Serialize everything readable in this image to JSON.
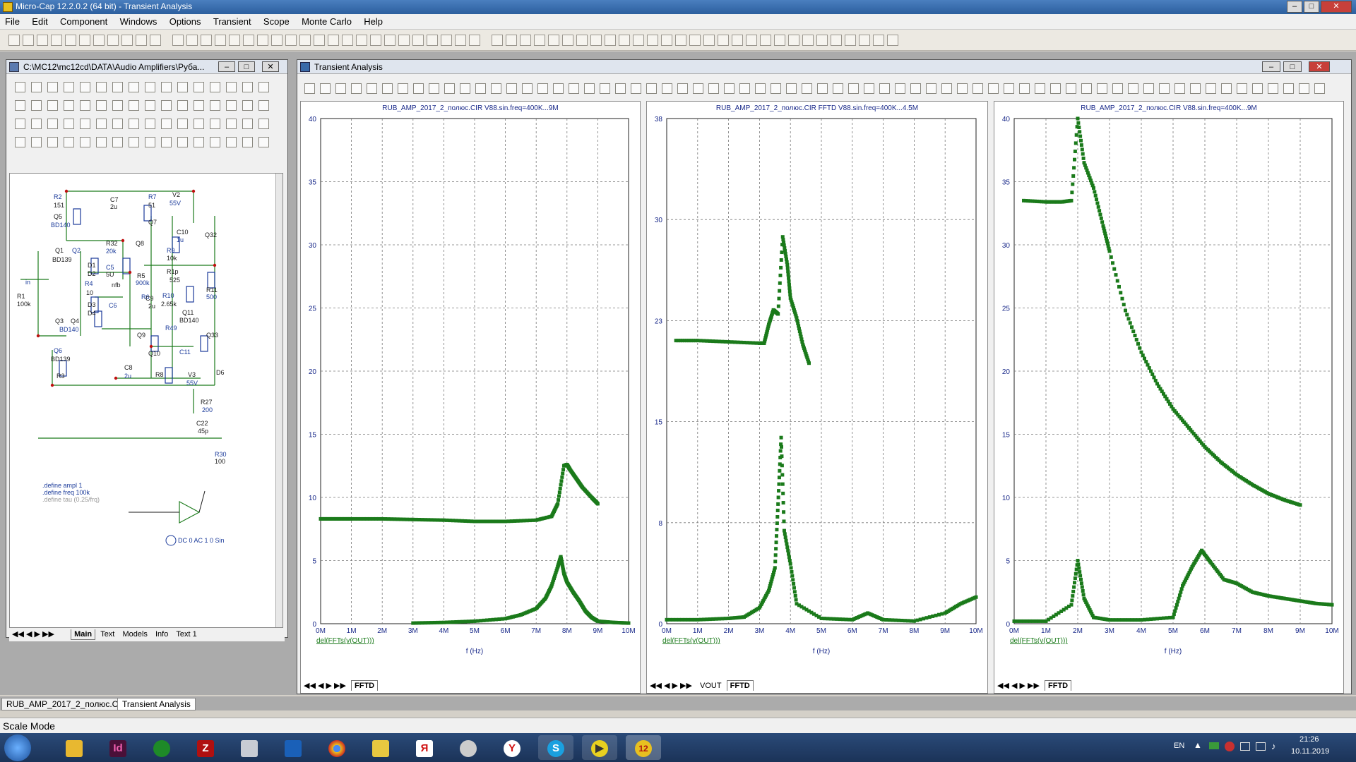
{
  "app": {
    "title": "Micro-Cap 12.2.0.2 (64 bit) - Transient Analysis"
  },
  "menu": [
    "File",
    "Edit",
    "Component",
    "Windows",
    "Options",
    "Transient",
    "Scope",
    "Monte Carlo",
    "Help"
  ],
  "schematic_window": {
    "title": "C:\\MC12\\mc12cd\\DATA\\Audio Amplifiers\\Руба...",
    "labels": [
      "R2",
      "151",
      "Q5",
      "BD140",
      "C7",
      "2u",
      "R7",
      "51",
      "V2",
      "55V",
      "Q7",
      "C10",
      "1u",
      "Q32",
      "Q8",
      "R9",
      "10k",
      "Q1",
      "Q2",
      "BD139",
      "R32",
      "20k",
      "D1",
      "D2",
      "C5",
      "5U",
      "R5",
      "900k",
      "R1p",
      "525",
      "R4",
      "10",
      "nfb",
      "R6",
      "C9",
      "2u",
      "R10",
      "2.65k",
      "R11",
      "500",
      "R1",
      "100k",
      "in",
      "D3",
      "D4",
      "C6",
      "Q11",
      "BD140",
      "R49",
      "Q3",
      "Q4",
      "BD140",
      "Q9",
      "Q33",
      "Q6",
      "BD139",
      "Q10",
      "C11",
      "D6",
      "C8",
      "2u",
      "R8",
      "V3",
      "55V",
      "R3",
      "R27",
      "200",
      "C22",
      "45p",
      "R30",
      "100"
    ],
    "defines": [
      ".define ampl 1",
      ".define freq 100k",
      ".define tau (0.25/frq)"
    ],
    "source_label": "DC 0 AC 1 0 Sin",
    "tabs": [
      "Main",
      "Text",
      "Models",
      "Info",
      "Text 1"
    ],
    "active_tab": "Main"
  },
  "transient_window": {
    "title": "Transient Analysis"
  },
  "plots": [
    {
      "title": "RUB_AMP_2017_2_полюс.CIR V88.sin.freq=400K...9M",
      "y_ticks": [
        "40",
        "35",
        "30",
        "25",
        "20",
        "15",
        "10",
        "5",
        "0"
      ],
      "x_ticks": [
        "0M",
        "1M",
        "2M",
        "3M",
        "4M",
        "5M",
        "6M",
        "7M",
        "8M",
        "9M",
        "10M"
      ],
      "curve_label": "del(FFTs(v(OUT)))",
      "xlabel": "f (Hz)",
      "tabs": [
        "FFTD"
      ],
      "active_tab": "FFTD"
    },
    {
      "title": "RUB_AMP_2017_2_полюс.CIR FFTD V88.sin.freq=400K...4.5M",
      "y_ticks": [
        "38",
        "30",
        "23",
        "15",
        "8",
        "0"
      ],
      "x_ticks": [
        "0M",
        "1M",
        "2M",
        "3M",
        "4M",
        "5M",
        "6M",
        "7M",
        "8M",
        "9M",
        "10M"
      ],
      "curve_label": "del(FFTs(v(OUT)))",
      "xlabel": "f (Hz)",
      "tabs": [
        "VOUT",
        "FFTD"
      ],
      "active_tab": "FFTD"
    },
    {
      "title": "RUB_AMP_2017_2_полюс.CIR V88.sin.freq=400K...9M",
      "y_ticks": [
        "40",
        "35",
        "30",
        "25",
        "20",
        "15",
        "10",
        "5",
        "0"
      ],
      "x_ticks": [
        "0M",
        "1M",
        "2M",
        "3M",
        "4M",
        "5M",
        "6M",
        "7M",
        "8M",
        "9M",
        "10M"
      ],
      "curve_label": "del(FFTs(v(OUT)))",
      "xlabel": "f (Hz)",
      "tabs": [
        "FFTD"
      ],
      "active_tab": "FFTD"
    }
  ],
  "chart_data": [
    {
      "type": "scatter",
      "title": "RUB_AMP_2017_2_полюс.CIR V88.sin.freq=400K...9M",
      "xlabel": "f (Hz)",
      "ylabel": "",
      "xlim": [
        0,
        10000000
      ],
      "ylim": [
        0,
        40
      ],
      "color": "#1a7a1a",
      "series": [
        {
          "name": "del(FFTs(v(OUT)))",
          "x": [
            0,
            500000,
            1000000,
            2000000,
            3000000,
            4000000,
            5000000,
            6000000,
            7000000,
            7500000,
            7700000,
            7900000,
            8000000,
            8100000,
            8300000,
            8500000,
            8800000,
            9000000
          ],
          "y": [
            8.3,
            8.3,
            8.3,
            8.3,
            8.25,
            8.2,
            8.1,
            8.1,
            8.2,
            8.5,
            9.5,
            12.5,
            12.6,
            12.2,
            11.5,
            10.8,
            10.0,
            9.5
          ]
        },
        {
          "name": "",
          "x": [
            3000000,
            4000000,
            5000000,
            6000000,
            6500000,
            7000000,
            7300000,
            7500000,
            7700000,
            7800000,
            7900000,
            8000000,
            8200000,
            8400000,
            8600000,
            8800000,
            9000000,
            9500000,
            10000000
          ],
          "y": [
            0.05,
            0.1,
            0.2,
            0.4,
            0.7,
            1.2,
            2.0,
            3.0,
            4.5,
            5.3,
            4.0,
            3.3,
            2.5,
            1.8,
            1.0,
            0.5,
            0.2,
            0.1,
            0.05
          ]
        }
      ]
    },
    {
      "type": "scatter",
      "title": "RUB_AMP_2017_2_полюс.CIR FFTD V88.sin.freq=400K...4.5M",
      "xlabel": "f (Hz)",
      "ylabel": "",
      "xlim": [
        0,
        10000000
      ],
      "ylim": [
        0,
        38
      ],
      "color": "#1a7a1a",
      "series": [
        {
          "name": "del(FFTs(v(OUT)))",
          "x": [
            300000,
            1000000,
            2000000,
            3000000,
            3150000,
            3300000,
            3450000,
            3600000,
            3750000,
            3900000,
            4000000,
            4200000,
            4400000,
            4600000
          ],
          "y": [
            21.3,
            21.3,
            21.2,
            21.1,
            21.1,
            22.5,
            23.6,
            23.3,
            29.1,
            27,
            24.5,
            23,
            21,
            19.6
          ]
        },
        {
          "name": "",
          "x": [
            0,
            1000000,
            2000000,
            2500000,
            3000000,
            3300000,
            3500000,
            3600000,
            3700000,
            3800000,
            4000000,
            4200000,
            5000000,
            6000000,
            6500000,
            7000000,
            8000000,
            9000000,
            9500000,
            10000000
          ],
          "y": [
            0.3,
            0.3,
            0.4,
            0.5,
            1.2,
            2.5,
            4.2,
            9,
            14,
            7,
            4.5,
            1.5,
            0.4,
            0.3,
            0.8,
            0.3,
            0.2,
            0.8,
            1.5,
            2.0
          ]
        }
      ]
    },
    {
      "type": "scatter",
      "title": "RUB_AMP_2017_2_полюс.CIR V88.sin.freq=400K...9M",
      "xlabel": "f (Hz)",
      "ylabel": "",
      "xlim": [
        0,
        10000000
      ],
      "ylim": [
        0,
        40
      ],
      "color": "#1a7a1a",
      "series": [
        {
          "name": "del(FFTs(v(OUT)))",
          "x": [
            300000,
            1000000,
            1500000,
            1800000,
            2000000,
            2200000,
            2500000,
            2800000,
            3000000,
            3500000,
            4000000,
            4500000,
            5000000,
            5500000,
            6000000,
            6500000,
            7000000,
            7500000,
            8000000,
            8500000,
            9000000
          ],
          "y": [
            33.5,
            33.4,
            33.4,
            33.5,
            40,
            36.5,
            34.5,
            31.5,
            29.5,
            24.8,
            21.5,
            19.0,
            17.0,
            15.5,
            14.0,
            12.8,
            11.8,
            11.0,
            10.3,
            9.8,
            9.4
          ]
        },
        {
          "name": "",
          "x": [
            0,
            1000000,
            1800000,
            2000000,
            2200000,
            2500000,
            3000000,
            4000000,
            5000000,
            5300000,
            5600000,
            5900000,
            6200000,
            6600000,
            7000000,
            7500000,
            8000000,
            8500000,
            9000000,
            9500000,
            10000000
          ],
          "y": [
            0.2,
            0.2,
            1.5,
            5.0,
            2.0,
            0.5,
            0.3,
            0.3,
            0.5,
            3.0,
            4.5,
            5.8,
            4.8,
            3.5,
            3.2,
            2.5,
            2.2,
            2.0,
            1.8,
            1.6,
            1.5
          ]
        }
      ]
    }
  ],
  "bottom_tabs": [
    "RUB_AMP_2017_2_полюс.CIR",
    "Transient Analysis"
  ],
  "status": {
    "mode": "Scale Mode"
  },
  "tray": {
    "lang": "EN",
    "time": "21:26",
    "date": "10.11.2019"
  }
}
